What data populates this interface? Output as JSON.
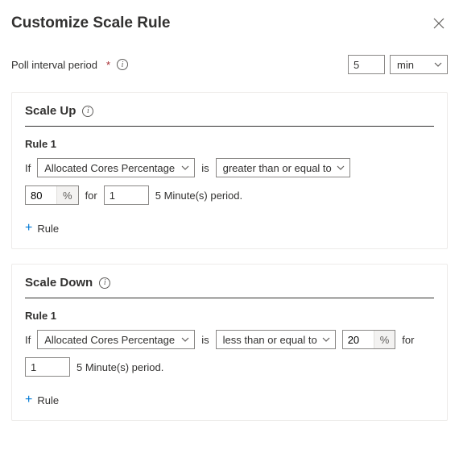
{
  "dialog": {
    "title": "Customize Scale Rule"
  },
  "poll": {
    "label": "Poll interval period",
    "required_marker": "*",
    "value": "5",
    "unit": "min"
  },
  "scale_up": {
    "title": "Scale Up",
    "rule_title": "Rule 1",
    "if": "If",
    "metric": "Allocated Cores Percentage",
    "is": "is",
    "operator": "greater than or equal to",
    "threshold": "80",
    "pct": "%",
    "for": "for",
    "period_value": "1",
    "period_text": "5 Minute(s) period.",
    "add_label": "Rule"
  },
  "scale_down": {
    "title": "Scale Down",
    "rule_title": "Rule 1",
    "if": "If",
    "metric": "Allocated Cores Percentage",
    "is": "is",
    "operator": "less than or equal to",
    "threshold": "20",
    "pct": "%",
    "for": "for",
    "period_value": "1",
    "period_text": "5 Minute(s) period.",
    "add_label": "Rule"
  }
}
